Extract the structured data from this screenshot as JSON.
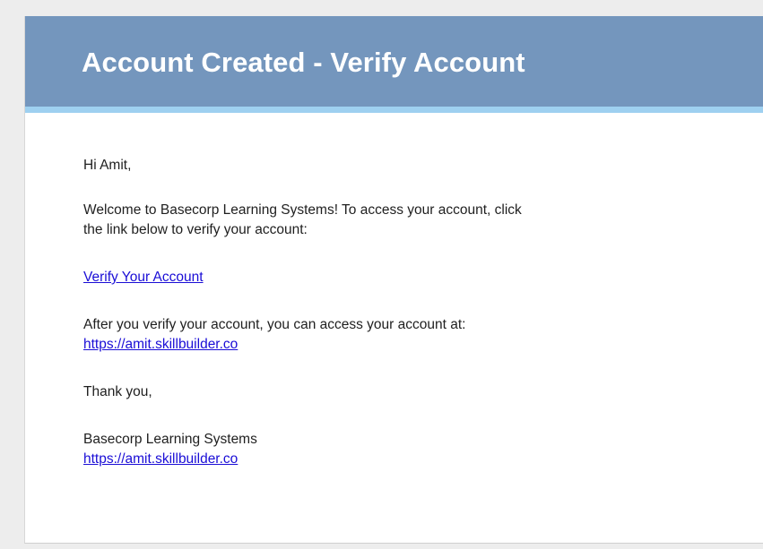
{
  "email": {
    "header": {
      "title": "Account Created - Verify Account"
    },
    "greeting": "Hi Amit,",
    "welcome_line_1": "Welcome to Basecorp Learning Systems! To access your account, click",
    "welcome_line_2": "the link below to verify your account:",
    "verify_link": "Verify Your Account",
    "after_verify_text": "After you verify your account, you can access your account at:",
    "account_url": "https://amit.skillbuilder.co",
    "thanks": "Thank you,",
    "signature_name": "Basecorp Learning Systems",
    "signature_url": "https://amit.skillbuilder.co"
  },
  "colors": {
    "header_background": "#7496bd",
    "header_accent": "#9ed0f0",
    "link": "#1a0dd6"
  }
}
